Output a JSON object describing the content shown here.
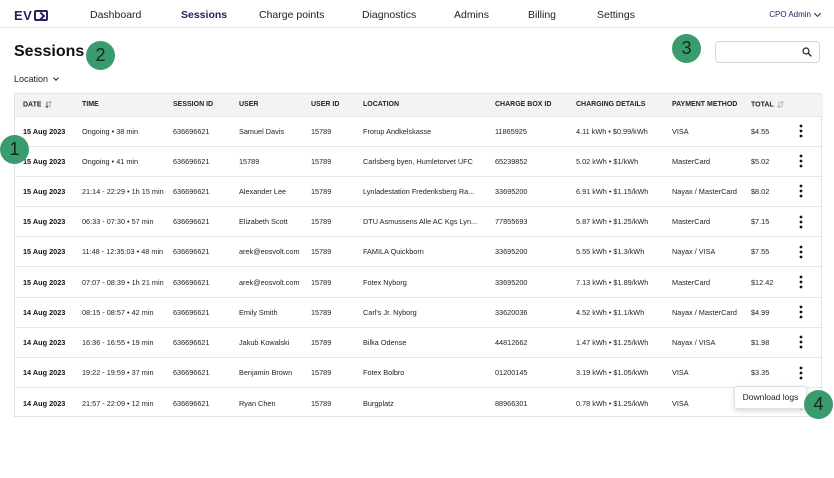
{
  "brand": {
    "name": "EV"
  },
  "nav": {
    "items": [
      {
        "label": "Dashboard",
        "active": false
      },
      {
        "label": "Sessions",
        "active": true
      },
      {
        "label": "Charge points",
        "active": false
      },
      {
        "label": "Diagnostics",
        "active": false
      },
      {
        "label": "Admins",
        "active": false
      },
      {
        "label": "Billing",
        "active": false
      },
      {
        "label": "Settings",
        "active": false
      }
    ],
    "account": "CPO Admin"
  },
  "page": {
    "title": "Sessions",
    "filter_label": "Location",
    "search": {
      "value": "",
      "placeholder": ""
    }
  },
  "callouts": [
    "1",
    "2",
    "3",
    "4"
  ],
  "table": {
    "columns": [
      "Date",
      "Time",
      "Session ID",
      "User",
      "User ID",
      "Location",
      "Charge box ID",
      "Charging details",
      "Payment method",
      "Total"
    ],
    "rows": [
      [
        "15 Aug 2023",
        "Ongoing • 38 min",
        "636696621",
        "Samuel Davis",
        "15789",
        "Frorup Andkelskasse",
        "11865925",
        "4.11 kWh • $0.99/kWh",
        "VISA",
        "$4.55"
      ],
      [
        "15 Aug 2023",
        "Ongoing • 41 min",
        "636696621",
        "15789",
        "15789",
        "Carlsberg byen, Humletorvet UFC",
        "65239852",
        "5.02 kWh • $1/kWh",
        "MasterCard",
        "$5.02"
      ],
      [
        "15 Aug 2023",
        "21:14 - 22:29 • 1h 15 min",
        "636696621",
        "Alexander Lee",
        "15789",
        "Lynladestation Frederiksberg Ra...",
        "33695200",
        "6.91 kWh • $1.15/kWh",
        "Nayax / MasterCard",
        "$8.02"
      ],
      [
        "15 Aug 2023",
        "06:33 - 07:30 • 57 min",
        "636696621",
        "Elizabeth Scott",
        "15789",
        "DTU Asmussens Alle AC Kgs Lyn...",
        "77855693",
        "5.87 kWh • $1.25/kWh",
        "MasterCard",
        "$7.15"
      ],
      [
        "15 Aug 2023",
        "11:48 - 12:35:03 • 48 min",
        "636696621",
        "arek@eosvolt.com",
        "15789",
        "FAMILA Quickborn",
        "33695200",
        "5.55 kWh • $1.3/kWh",
        "Nayax / VISA",
        "$7.55"
      ],
      [
        "15 Aug 2023",
        "07:07 - 08:39 • 1h 21 min",
        "636696621",
        "arek@eosvolt.com",
        "15789",
        "Fotex Nyborg",
        "33695200",
        "7.13 kWh • $1.89/kWh",
        "MasterCard",
        "$12.42"
      ],
      [
        "14 Aug 2023",
        "08:15 - 08:57 • 42 min",
        "636696621",
        "Emily Smith",
        "15789",
        "Carl's Jr. Nyborg",
        "33620036",
        "4.52 kWh • $1.1/kWh",
        "Nayax / MasterCard",
        "$4.99"
      ],
      [
        "14 Aug 2023",
        "16:36 - 16:55 • 19 min",
        "636696621",
        "Jakub Kowalski",
        "15789",
        "Bilka Odense",
        "44812662",
        "1.47 kWh • $1.25/kWh",
        "Nayax / VISA",
        "$1.98"
      ],
      [
        "14 Aug 2023",
        "19:22 - 19:59 • 37 min",
        "636696621",
        "Benjamin Brown",
        "15789",
        "Fotex Bolbro",
        "01200145",
        "3.19 kWh • $1.05/kWh",
        "VISA",
        "$3.35"
      ],
      [
        "14 Aug 2023",
        "21:57 - 22:09 • 12 min",
        "636696621",
        "Ryan Chen",
        "15789",
        "Burgplatz",
        "88966301",
        "0.78 kWh • $1.25/kWh",
        "VISA",
        ""
      ]
    ]
  },
  "row_menu": {
    "item": "Download logs"
  },
  "colors": {
    "accent": "#2a2060",
    "callout": "#3a9c6e",
    "header_bg": "#f3f3f3"
  },
  "icons": [
    "search-icon",
    "sort-icon",
    "chevron-down-icon",
    "kebab-menu-icon"
  ]
}
